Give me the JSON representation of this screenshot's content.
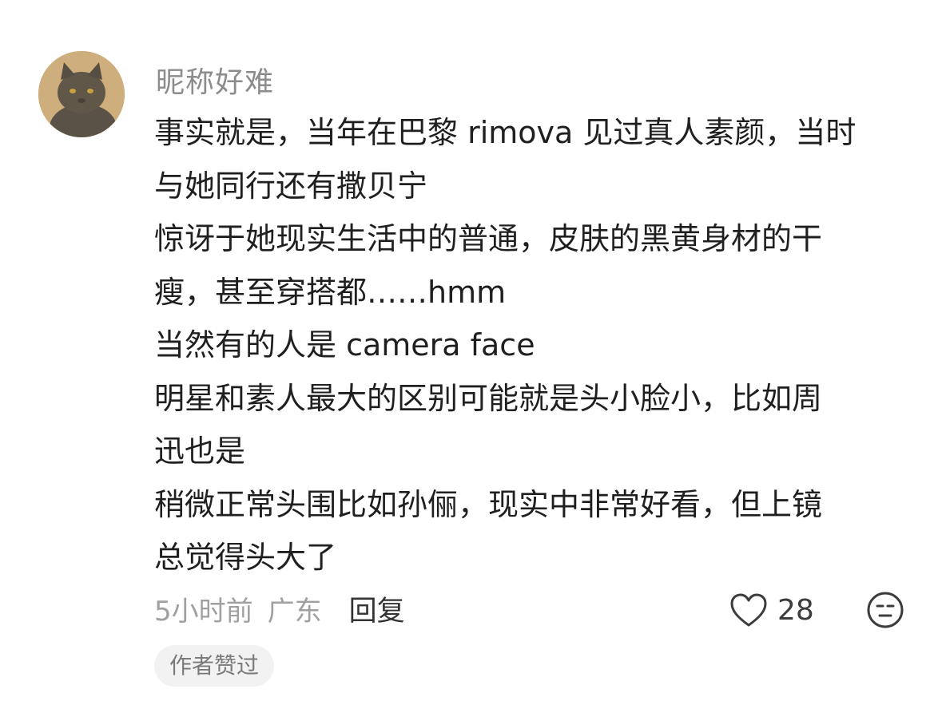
{
  "comment": {
    "username": "昵称好难",
    "body_lines": [
      "事实就是，当年在巴黎 rimova 见过真人素颜，当时",
      "与她同行还有撒贝宁",
      "惊讶于她现实生活中的普通，皮肤的黑黄身材的干",
      "瘦，甚至穿搭都……hmm",
      "当然有的人是 camera face",
      "明星和素人最大的区别可能就是头小脸小，比如周",
      "迅也是",
      "稍微正常头围比如孙俪，现实中非常好看，但上镜",
      "总觉得头大了"
    ],
    "time": "5小时前",
    "region": "广东",
    "reply_label": "回复",
    "like_count": "28",
    "author_badge": "作者赞过"
  },
  "icons": {
    "avatar": "cat-avatar",
    "like": "heart-outline-icon",
    "dislike": "neutral-face-icon"
  }
}
